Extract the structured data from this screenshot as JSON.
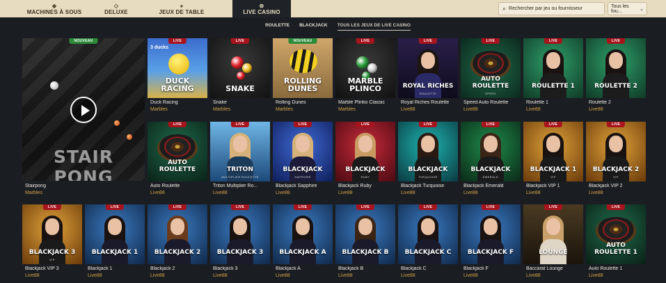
{
  "topnav": {
    "categories": [
      {
        "label": "MACHINES À SOUS",
        "icon": "diamond-icon"
      },
      {
        "label": "DELUXE",
        "icon": "diamond-icon"
      },
      {
        "label": "JEUX DE TABLE",
        "icon": "cards-icon"
      },
      {
        "label": "LIVE CASINO",
        "icon": "chip-icon"
      }
    ],
    "search_placeholder": "Rechercher par jeu ou fournisseur",
    "filter_label": "Tous les fou...",
    "filter_icon": "chevron-down-icon"
  },
  "subnav": {
    "tabs": [
      {
        "label": "ROULETTE"
      },
      {
        "label": "BLACKJACK"
      },
      {
        "label": "TOUS LES JEUX DE LIVE CASINO"
      }
    ]
  },
  "featured": {
    "badge": "NOUVEAU",
    "art_title": "STAIR PONG",
    "name": "Stairpong",
    "provider": "Marbles"
  },
  "games": [
    {
      "badge": "LIVE",
      "art_title": "DUCK RACING",
      "art_top": "3 ducks",
      "art_sub": "",
      "name": "Duck Racing",
      "provider": "Marbles"
    },
    {
      "badge": "LIVE",
      "art_title": "SNAKE",
      "art_top": "",
      "art_sub": "",
      "name": "Snake",
      "provider": "Marbles"
    },
    {
      "badge": "NOUVEAU",
      "art_title": "ROLLING DUNES",
      "art_top": "",
      "art_sub": "",
      "name": "Rolling Dunes",
      "provider": "Marbles"
    },
    {
      "badge": "LIVE",
      "art_title": "MARBLE PLINCO",
      "art_top": "",
      "art_sub": "",
      "name": "Marble Plinko Classic",
      "provider": "Marbles"
    },
    {
      "badge": "LIVE",
      "art_title": "ROYAL RICHES",
      "art_top": "",
      "art_sub": "ROULETTE",
      "name": "Royal Riches Roulette",
      "provider": "Live88"
    },
    {
      "badge": "LIVE",
      "art_title": "AUTO ROULETTE",
      "art_top": "",
      "art_sub": "SPEED",
      "name": "Speed Auto Roulette",
      "provider": "Live88"
    },
    {
      "badge": "LIVE",
      "art_title": "ROULETTE 1",
      "art_top": "",
      "art_sub": "",
      "name": "Roulette 1",
      "provider": "Live88"
    },
    {
      "badge": "LIVE",
      "art_title": "ROULETTE 2",
      "art_top": "",
      "art_sub": "",
      "name": "Roulette 2",
      "provider": "Live88"
    },
    {
      "badge": "LIVE",
      "art_title": "AUTO ROULETTE",
      "art_top": "",
      "art_sub": "",
      "name": "Auto Roulette",
      "provider": "Live88"
    },
    {
      "badge": "LIVE",
      "art_title": "TRITON",
      "art_top": "",
      "art_sub": "MULTIPLIER ROULETTE",
      "name": "Triton Multiplier Ro...",
      "provider": "Live88"
    },
    {
      "badge": "LIVE",
      "art_title": "BLACKJACK",
      "art_top": "",
      "art_sub": "SAPPHIRE",
      "name": "Blackjack Sapphire",
      "provider": "Live88"
    },
    {
      "badge": "LIVE",
      "art_title": "BLACKJACK",
      "art_top": "",
      "art_sub": "RUBY",
      "name": "Blackjack Ruby",
      "provider": "Live88"
    },
    {
      "badge": "LIVE",
      "art_title": "BLACKJACK",
      "art_top": "",
      "art_sub": "TURQUOISE",
      "name": "Blackjack Turquoise",
      "provider": "Live88"
    },
    {
      "badge": "LIVE",
      "art_title": "BLACKJACK",
      "art_top": "",
      "art_sub": "EMERALD",
      "name": "Blackjack Emerald",
      "provider": "Live88"
    },
    {
      "badge": "LIVE",
      "art_title": "BLACKJACK 1",
      "art_top": "",
      "art_sub": "VIP",
      "name": "Blackjack VIP 1",
      "provider": "Live88"
    },
    {
      "badge": "LIVE",
      "art_title": "BLACKJACK 2",
      "art_top": "",
      "art_sub": "VIP",
      "name": "Blackjack VIP 2",
      "provider": "Live88"
    },
    {
      "badge": "LIVE",
      "art_title": "BLACKJACK 3",
      "art_top": "",
      "art_sub": "VIP",
      "name": "Blackjack VIP 3",
      "provider": "Live88"
    },
    {
      "badge": "LIVE",
      "art_title": "BLACKJACK 1",
      "art_top": "",
      "art_sub": "",
      "name": "Blackjack 1",
      "provider": "Live88"
    },
    {
      "badge": "LIVE",
      "art_title": "BLACKJACK 2",
      "art_top": "",
      "art_sub": "",
      "name": "Blackjack 2",
      "provider": "Live88"
    },
    {
      "badge": "LIVE",
      "art_title": "BLACKJACK 3",
      "art_top": "",
      "art_sub": "",
      "name": "Blackjack 3",
      "provider": "Live88"
    },
    {
      "badge": "LIVE",
      "art_title": "BLACKJACK A",
      "art_top": "",
      "art_sub": "",
      "name": "Blackjack A",
      "provider": "Live88"
    },
    {
      "badge": "LIVE",
      "art_title": "BLACKJACK B",
      "art_top": "",
      "art_sub": "",
      "name": "Blackjack B",
      "provider": "Live88"
    },
    {
      "badge": "LIVE",
      "art_title": "BLACKJACK C",
      "art_top": "",
      "art_sub": "",
      "name": "Blackjack C",
      "provider": "Live88"
    },
    {
      "badge": "LIVE",
      "art_title": "BLACKJACK F",
      "art_top": "",
      "art_sub": "",
      "name": "Blackjack F",
      "provider": "Live88"
    },
    {
      "badge": "LIVE",
      "art_title": "LOUNGE",
      "art_top": "",
      "art_sub": "BACCARAT",
      "name": "Baccarat Lounge",
      "provider": "Live88"
    },
    {
      "badge": "LIVE",
      "art_title": "AUTO ROULETTE 1",
      "art_top": "",
      "art_sub": "",
      "name": "Auto Roulette 1",
      "provider": "Live88"
    }
  ],
  "colors": {
    "accent_gold": "#d6a447",
    "badge_live": "#a8141d",
    "badge_new": "#2c8a3a",
    "topbar_bg": "#e8dcc0",
    "page_bg": "#1a1d22"
  }
}
